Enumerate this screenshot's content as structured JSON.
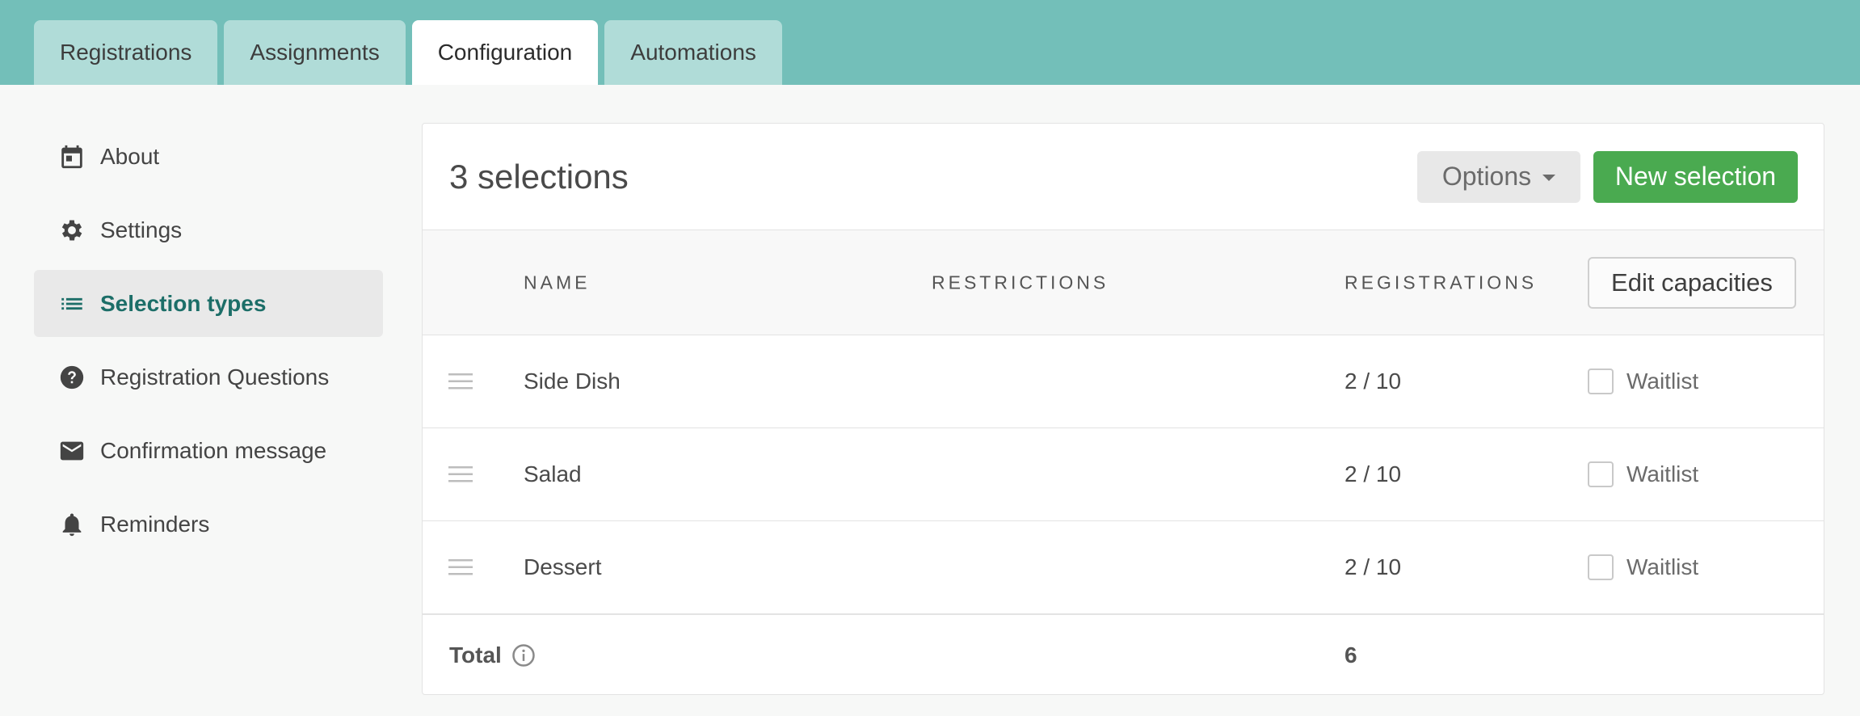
{
  "tabs": [
    {
      "label": "Registrations",
      "active": false
    },
    {
      "label": "Assignments",
      "active": false
    },
    {
      "label": "Configuration",
      "active": true
    },
    {
      "label": "Automations",
      "active": false
    }
  ],
  "sidebar": {
    "items": [
      {
        "label": "About",
        "icon": "calendar-icon",
        "active": false
      },
      {
        "label": "Settings",
        "icon": "gear-icon",
        "active": false
      },
      {
        "label": "Selection types",
        "icon": "list-icon",
        "active": true
      },
      {
        "label": "Registration Questions",
        "icon": "question-icon",
        "active": false
      },
      {
        "label": "Confirmation message",
        "icon": "envelope-icon",
        "active": false
      },
      {
        "label": "Reminders",
        "icon": "bell-icon",
        "active": false
      }
    ]
  },
  "panel": {
    "title": "3 selections",
    "options_label": "Options",
    "new_selection_label": "New selection",
    "columns": {
      "name": "NAME",
      "restrictions": "RESTRICTIONS",
      "registrations": "REGISTRATIONS"
    },
    "edit_capacities_label": "Edit capacities",
    "rows": [
      {
        "name": "Side Dish",
        "restrictions": "",
        "registrations": "2 / 10",
        "waitlist_label": "Waitlist",
        "waitlist_checked": false
      },
      {
        "name": "Salad",
        "restrictions": "",
        "registrations": "2 / 10",
        "waitlist_label": "Waitlist",
        "waitlist_checked": false
      },
      {
        "name": "Dessert",
        "restrictions": "",
        "registrations": "2 / 10",
        "waitlist_label": "Waitlist",
        "waitlist_checked": false
      }
    ],
    "total_label": "Total",
    "total_value": "6"
  },
  "colors": {
    "topbar": "#73bfb9",
    "tab_inactive": "#b0dcd8",
    "active_accent": "#1c6e68",
    "primary_button": "#4aaa50"
  }
}
